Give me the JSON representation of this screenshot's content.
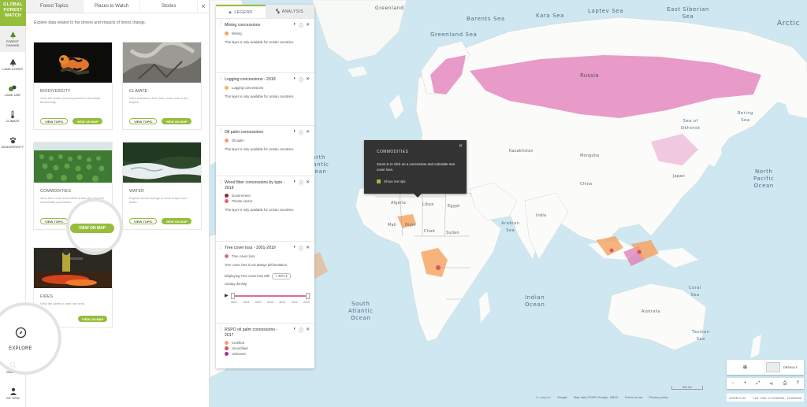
{
  "brand": {
    "line1": "GLOBAL",
    "line2": "FOREST",
    "line3": "WATCH"
  },
  "nav": {
    "items": [
      {
        "label": "Forest change",
        "icon": "forest-change-icon"
      },
      {
        "label": "Land cover",
        "icon": "tree-icon"
      },
      {
        "label": "Land use",
        "icon": "land-use-icon"
      },
      {
        "label": "Climate",
        "icon": "thermometer-icon"
      },
      {
        "label": "Biodiversity",
        "icon": "paw-icon"
      }
    ],
    "explore": "EXPLORE",
    "search": "SEARCH",
    "my_gfw": "MY GFW"
  },
  "panel": {
    "tabs": [
      "Forest Topics",
      "Places to Watch",
      "Stories"
    ],
    "close": "×",
    "intro": "Explore data related to the drivers and impacts of forest change.",
    "topics": [
      {
        "title": "BIODIVERSITY",
        "desc": "View the areas most important to terrestrial biodiversity.",
        "view_topic": "VIEW TOPIC",
        "view_map": "VIEW ON MAP"
      },
      {
        "title": "CLIMATE",
        "desc": "View emissions from tree cover loss in the tropics.",
        "view_topic": "VIEW TOPIC",
        "view_map": "VIEW ON MAP"
      },
      {
        "title": "COMMODITIES",
        "desc": "View tree cover loss within areas allocated for commodity production.",
        "view_topic": "VIEW TOPIC",
        "view_map": "VIEW ON MAP"
      },
      {
        "title": "WATER",
        "desc": "Explore forest change in each major river basin.",
        "view_topic": "VIEW TOPIC",
        "view_map": "VIEW ON MAP"
      },
      {
        "title": "FIRES",
        "desc": "View the alerts in near real time.",
        "view_map": "VIEW ON MAP"
      }
    ]
  },
  "legend": {
    "tabs": [
      "LEGEND",
      "ANALYSIS"
    ],
    "layers": [
      {
        "title": "Mining concessions",
        "items": [
          {
            "label": "Mining",
            "color": "#f5a25d"
          }
        ],
        "note": "This layer is only available for certain countries."
      },
      {
        "title": "Logging concessions - 2018",
        "items": [
          {
            "label": "Logging concessions",
            "color": "#f5b35d"
          }
        ],
        "note": "This layer is only available for certain countries."
      },
      {
        "title": "Oil palm concessions",
        "items": [
          {
            "label": "Oil palm",
            "color": "#f59a6a"
          }
        ],
        "note": "This layer is only available for certain countries."
      },
      {
        "title": "Wood fiber concessions by type - 2019",
        "items": [
          {
            "label": "Government",
            "color": "#8c2d2d"
          },
          {
            "label": "Private sector",
            "color": "#f05a7b"
          }
        ],
        "note": "This layer is only available for certain countries."
      },
      {
        "title": "Tree cover loss - 2001-2019",
        "items": [
          {
            "label": "Tree cover loss",
            "color": "#dc6c9a"
          }
        ],
        "note": "Tree cover loss is not always deforestation.",
        "canopy_prefix": "Displaying Tree cover loss with",
        "canopy_value": "> 30%",
        "canopy_suffix": "canopy density.",
        "years": [
          "2001",
          "2004",
          "2007",
          "2010",
          "2013",
          "2016",
          "2019"
        ]
      },
      {
        "title": "RSPO oil palm concessions - 2017",
        "items": [
          {
            "label": "Certified",
            "color": "#f5a25d"
          },
          {
            "label": "Uncertified",
            "color": "#e7467b"
          },
          {
            "label": "Unknown",
            "color": "#9e3a8f"
          }
        ]
      }
    ]
  },
  "popup": {
    "title": "COMMODITIES",
    "body": "Zoom in to click on a concession and calculate tree cover loss.",
    "checkbox": "Show me tips"
  },
  "map_labels": {
    "greenland": "Greenland",
    "greenland_sea": "Greenland Sea",
    "barents_sea": "Barents Sea",
    "kara_sea": "Kara Sea",
    "laptev_sea": "Laptev Sea",
    "east_siberian_sea": "East Siberian Sea",
    "arctic": "Arctic",
    "north_atlantic": "North\nAtlantic\nOcean",
    "north_pacific": "North\nPacific\nOcean",
    "south_atlantic": "South\nAtlantic\nOcean",
    "indian_ocean": "Indian\nOcean",
    "russia": "Russia",
    "kazakhstan": "Kazakhstan",
    "mongolia": "Mongolia",
    "china": "China",
    "japan": "Japan",
    "sea_of_okhotsk": "Sea of\nOkhotsk",
    "bering_sea": "Bering\nSea",
    "arabian_sea": "Arabian\nSea",
    "algeria": "Algeria",
    "libya": "Libya",
    "egypt": "Egypt",
    "mali": "Mali",
    "niger": "Niger",
    "chad": "Chad",
    "sudan": "Sudan",
    "india": "India",
    "australia": "Australia",
    "coral_sea": "Coral\nSea",
    "tasman_sea": "Tasman\nSea"
  },
  "controls": {
    "basemap": "DEFAULT",
    "attribution": [
      "Google",
      "Map data ©2020 Google, INEGI",
      "Terms of use",
      "Privacy policy"
    ],
    "zoom_level": "ZOOM 2.00",
    "latlng": "LAT, LNG: 27.2000001, 13.000000",
    "scale": "500 km"
  },
  "colors": {
    "accent": "#97bd3d",
    "loss": "#e05fa9",
    "land": "#ffffff",
    "water": "#cfe7f0"
  }
}
